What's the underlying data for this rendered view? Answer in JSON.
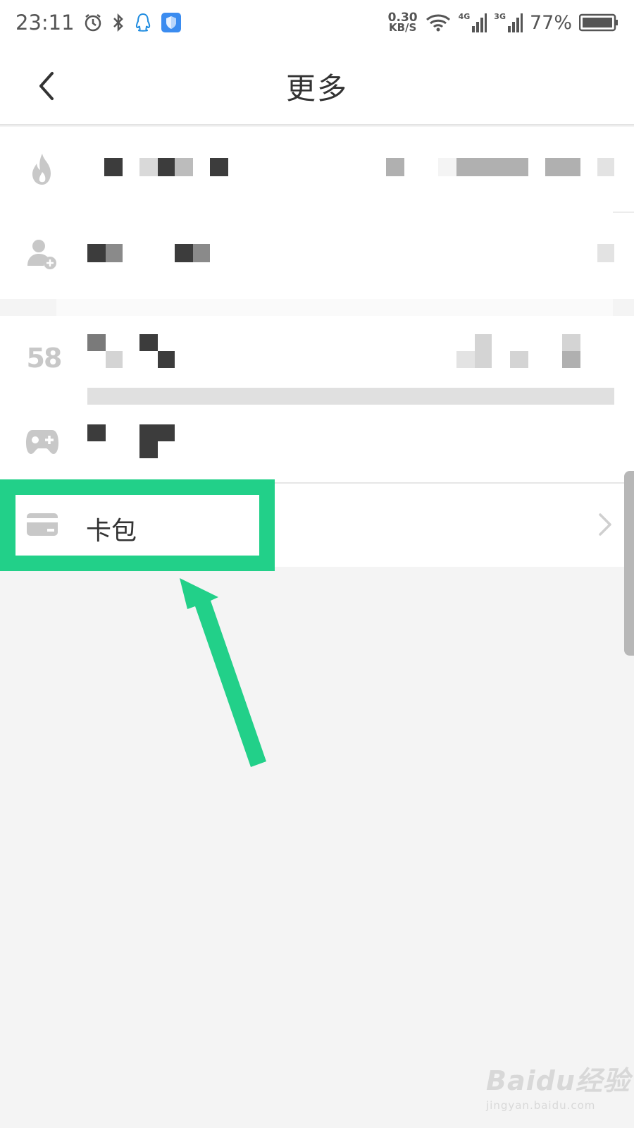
{
  "status_bar": {
    "time": "23:11",
    "speed_value": "0.30",
    "speed_unit": "KB/S",
    "net1": "4G",
    "net2": "3G",
    "battery": "77%",
    "icons": [
      "alarm-icon",
      "bluetooth-icon",
      "qq-icon",
      "shield-icon",
      "wifi-icon",
      "signal-icon",
      "battery-icon"
    ]
  },
  "nav": {
    "title": "更多",
    "back_icon": "chevron-left-icon"
  },
  "menu": {
    "items": [
      {
        "icon": "flame-icon",
        "label": ""
      },
      {
        "icon": "add-user-icon",
        "label": ""
      },
      {
        "icon": "58-icon",
        "icon_text": "58",
        "label": ""
      },
      {
        "icon": "gamepad-icon",
        "label": ""
      }
    ],
    "card_item": {
      "icon": "card-icon",
      "label": "卡包",
      "arrow_icon": "chevron-right-icon"
    }
  },
  "colors": {
    "annotation": "#22d089",
    "background": "#f4f4f4",
    "row_bg": "#ffffff",
    "icon_gray": "#c8c8c8"
  },
  "watermark": {
    "main": "Baidu经验",
    "sub": "jingyan.baidu.com"
  }
}
